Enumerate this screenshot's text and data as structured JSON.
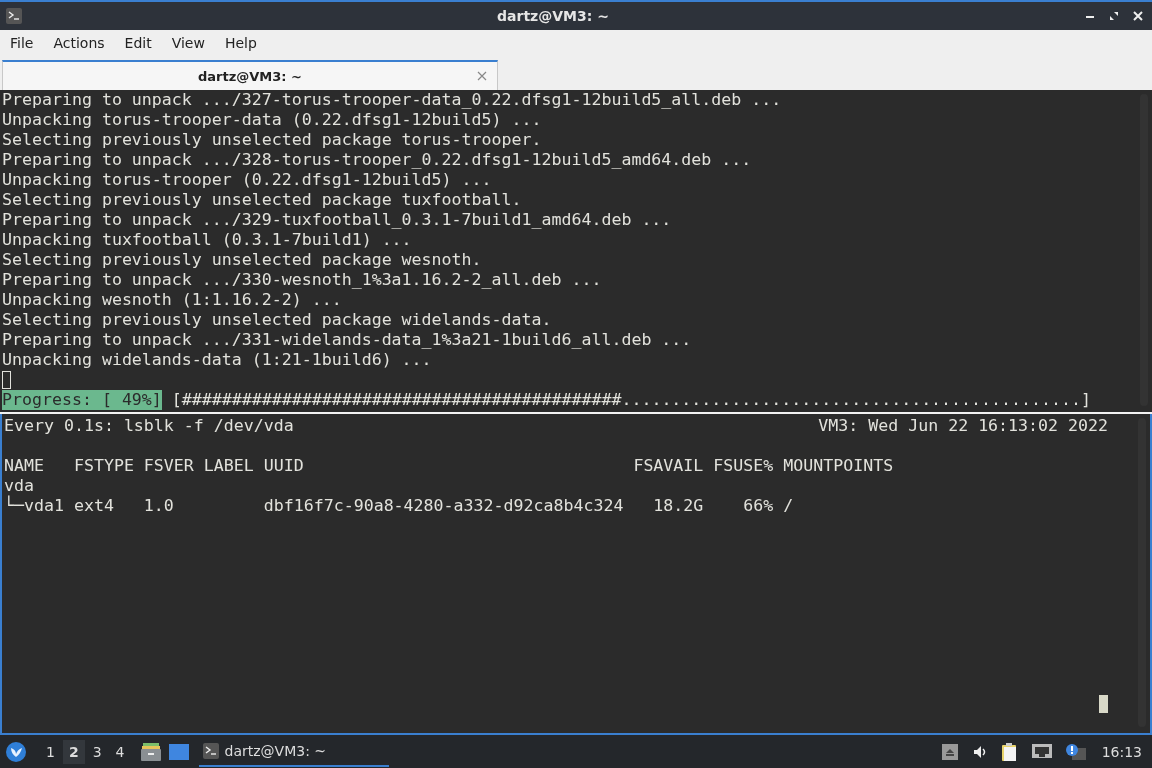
{
  "window": {
    "title": "dartz@VM3: ~",
    "active": true
  },
  "menu": [
    "File",
    "Actions",
    "Edit",
    "View",
    "Help"
  ],
  "tabs": [
    {
      "label": "dartz@VM3: ~",
      "selected": true
    }
  ],
  "top_pane": {
    "lines": [
      "Preparing to unpack .../327-torus-trooper-data_0.22.dfsg1-12build5_all.deb ...",
      "Unpacking torus-trooper-data (0.22.dfsg1-12build5) ...",
      "Selecting previously unselected package torus-trooper.",
      "Preparing to unpack .../328-torus-trooper_0.22.dfsg1-12build5_amd64.deb ...",
      "Unpacking torus-trooper (0.22.dfsg1-12build5) ...",
      "Selecting previously unselected package tuxfootball.",
      "Preparing to unpack .../329-tuxfootball_0.3.1-7build1_amd64.deb ...",
      "Unpacking tuxfootball (0.3.1-7build1) ...",
      "Selecting previously unselected package wesnoth.",
      "Preparing to unpack .../330-wesnoth_1%3a1.16.2-2_all.deb ...",
      "Unpacking wesnoth (1:1.16.2-2) ...",
      "Selecting previously unselected package widelands-data.",
      "Preparing to unpack .../331-widelands-data_1%3a21-1build6_all.deb ...",
      "Unpacking widelands-data (1:21-1build6) ..."
    ],
    "progress": {
      "label": "Progress: [ 49%]",
      "bar": "[############################################..............................................]"
    }
  },
  "bottom_pane": {
    "header_left": "Every 0.1s: lsblk -f /dev/vda",
    "header_right": "VM3: Wed Jun 22 16:13:02 2022",
    "lines": [
      "NAME   FSTYPE FSVER LABEL UUID                                 FSAVAIL FSUSE% MOUNTPOINTS",
      "vda",
      "└─vda1 ext4   1.0         dbf16f7c-90a8-4280-a332-d92ca8b4c324   18.2G    66% /"
    ]
  },
  "taskbar": {
    "desktops": [
      {
        "label": "1",
        "selected": false
      },
      {
        "label": "2",
        "selected": true
      },
      {
        "label": "3",
        "selected": false
      },
      {
        "label": "4",
        "selected": false
      }
    ],
    "tasks": [
      {
        "label": "dartz@VM3: ~",
        "selected": true
      }
    ],
    "clock": "16:13"
  }
}
